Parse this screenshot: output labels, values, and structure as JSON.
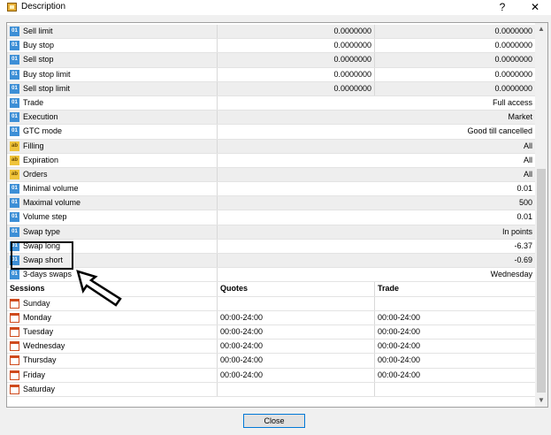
{
  "window": {
    "title": "Description",
    "help_label": "?",
    "close_label": "✕"
  },
  "properties": [
    {
      "name": "Sell limit",
      "icon": "number-icon",
      "quote": "0.0000000",
      "trade": "0.0000000",
      "shaded": true
    },
    {
      "name": "Buy stop",
      "icon": "number-icon",
      "quote": "0.0000000",
      "trade": "0.0000000",
      "shaded": false
    },
    {
      "name": "Sell stop",
      "icon": "number-icon",
      "quote": "0.0000000",
      "trade": "0.0000000",
      "shaded": true
    },
    {
      "name": "Buy stop limit",
      "icon": "number-icon",
      "quote": "0.0000000",
      "trade": "0.0000000",
      "shaded": false
    },
    {
      "name": "Sell stop limit",
      "icon": "number-icon",
      "quote": "0.0000000",
      "trade": "0.0000000",
      "shaded": true
    },
    {
      "name": "Trade",
      "icon": "number-icon",
      "value": "Full access",
      "shaded": false
    },
    {
      "name": "Execution",
      "icon": "number-icon",
      "value": "Market",
      "shaded": true
    },
    {
      "name": "GTC mode",
      "icon": "number-icon",
      "value": "Good till cancelled",
      "shaded": false
    },
    {
      "name": "Filling",
      "icon": "text-icon",
      "value": "All",
      "shaded": true
    },
    {
      "name": "Expiration",
      "icon": "text-icon",
      "value": "All",
      "shaded": false
    },
    {
      "name": "Orders",
      "icon": "text-icon",
      "value": "All",
      "shaded": true
    },
    {
      "name": "Minimal volume",
      "icon": "number-icon",
      "value": "0.01",
      "shaded": false
    },
    {
      "name": "Maximal volume",
      "icon": "number-icon",
      "value": "500",
      "shaded": true
    },
    {
      "name": "Volume step",
      "icon": "number-icon",
      "value": "0.01",
      "shaded": false
    },
    {
      "name": "Swap type",
      "icon": "number-icon",
      "value": "In points",
      "shaded": true
    },
    {
      "name": "Swap long",
      "icon": "number-icon",
      "value": "-6.37",
      "shaded": false
    },
    {
      "name": "Swap short",
      "icon": "number-icon",
      "value": "-0.69",
      "shaded": true
    },
    {
      "name": "3-days swaps",
      "icon": "number-icon",
      "value": "Wednesday",
      "shaded": false
    }
  ],
  "sessions": {
    "headers": [
      "Sessions",
      "Quotes",
      "Trade"
    ],
    "rows": [
      {
        "day": "Sunday",
        "quotes": "",
        "trade": ""
      },
      {
        "day": "Monday",
        "quotes": "00:00-24:00",
        "trade": "00:00-24:00"
      },
      {
        "day": "Tuesday",
        "quotes": "00:00-24:00",
        "trade": "00:00-24:00"
      },
      {
        "day": "Wednesday",
        "quotes": "00:00-24:00",
        "trade": "00:00-24:00"
      },
      {
        "day": "Thursday",
        "quotes": "00:00-24:00",
        "trade": "00:00-24:00"
      },
      {
        "day": "Friday",
        "quotes": "00:00-24:00",
        "trade": "00:00-24:00"
      },
      {
        "day": "Saturday",
        "quotes": "",
        "trade": ""
      }
    ]
  },
  "icons": {
    "number_icon_glyph": "01",
    "text_icon_glyph": "ab"
  },
  "colors": {
    "number_icon": "#3d8fd6",
    "text_icon": "#efc33a",
    "calendar_icon": "#cf4a1c"
  },
  "footer": {
    "close_label": "Close"
  }
}
